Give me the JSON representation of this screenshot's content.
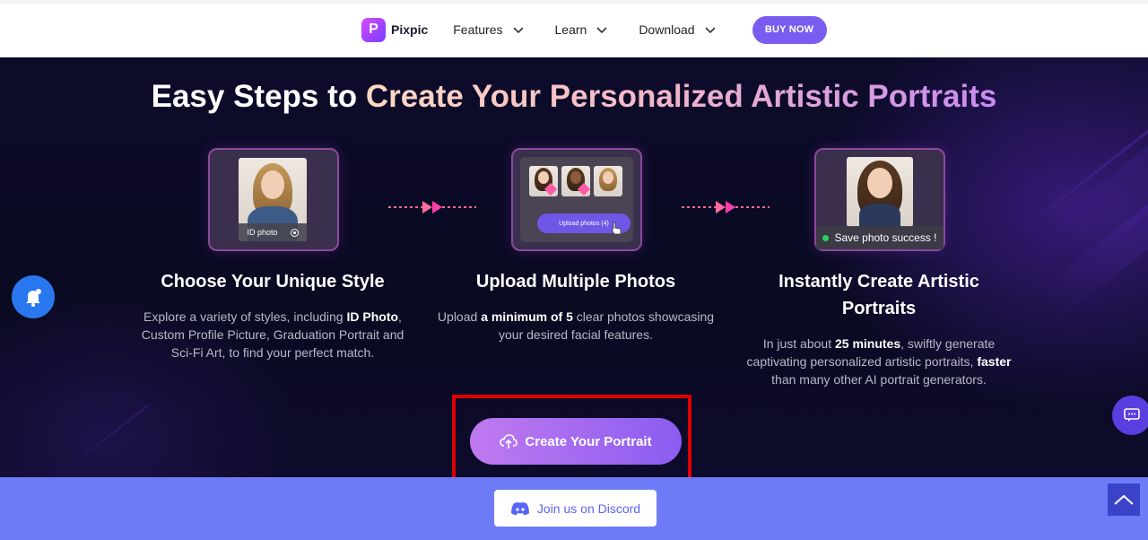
{
  "nav": {
    "logo_text": "Pixpic",
    "items": [
      {
        "label": "Features"
      },
      {
        "label": "Learn"
      },
      {
        "label": "Download"
      }
    ],
    "buy_label": "BUY NOW"
  },
  "hero": {
    "title_plain": "Easy Steps to ",
    "title_highlight": "Create Your Personalized Artistic Portraits",
    "steps": [
      {
        "caption": "ID photo",
        "title": "Choose Your Unique Style",
        "desc_parts": [
          "Explore a variety of styles, including ",
          "ID Photo",
          ", Custom Profile Picture, Graduation Portrait and Sci-Fi Art, to find your perfect match."
        ]
      },
      {
        "caption": "Upload photos (4)",
        "title": "Upload Multiple Photos",
        "desc_parts": [
          "Upload ",
          "a minimum of 5",
          " clear photos showcasing your desired facial features."
        ]
      },
      {
        "caption": "Save photo success !",
        "title_line1": "Instantly Create Artistic",
        "title_line2": "Portraits",
        "desc_parts": [
          "In just about ",
          "25 minutes",
          ", swiftly generate captivating personalized artistic portraits, ",
          "faster",
          " than many other AI portrait generators."
        ]
      }
    ],
    "cta_label": "Create Your Portrait"
  },
  "footer": {
    "discord_label": "Join us on Discord"
  },
  "colors": {
    "accent": "#7a5cf0",
    "cta_start": "#c07af0",
    "cta_end": "#8a5cf0",
    "band": "#6d7cf6",
    "highlight": "#e00000"
  }
}
